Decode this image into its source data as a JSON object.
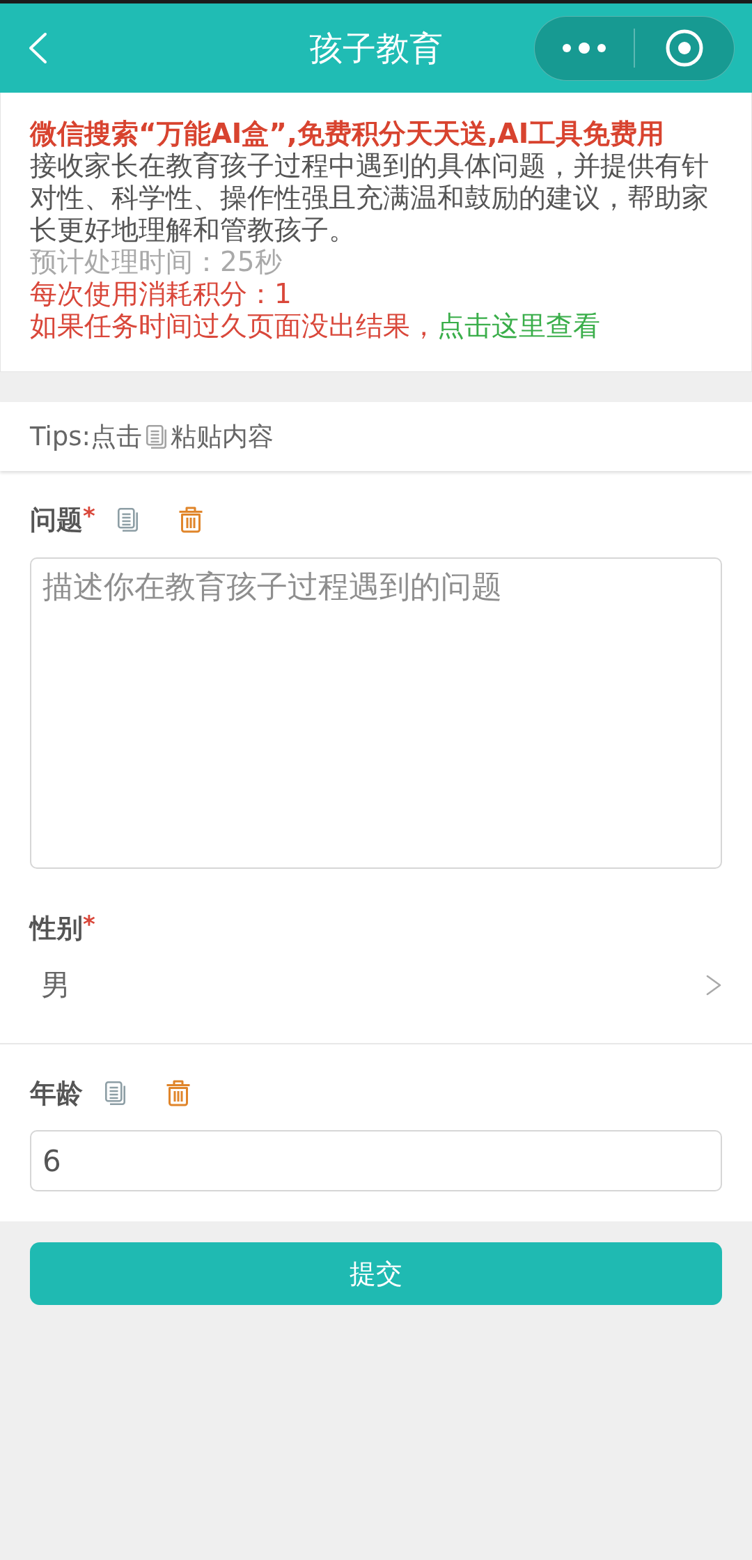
{
  "header": {
    "title": "孩子教育"
  },
  "info_card": {
    "promo": "微信搜索“万能AI盒”,免费积分天天送,AI工具免费用",
    "description": "接收家长在教育孩子过程中遇到的具体问题，并提供有针对性、科学性、操作性强且充满温和鼓励的建议，帮助家长更好地理解和管教孩子。",
    "estimated_time": "预计处理时间：25秒",
    "cost": "每次使用消耗积分：1",
    "timeout_note": "如果任务时间过久页面没出结果，",
    "timeout_link": "点击这里查看"
  },
  "tips": {
    "lead": "Tips:点击",
    "trail": "粘贴内容"
  },
  "fields": [
    {
      "kind": "textarea",
      "label": "问题",
      "required_mark": "*",
      "placeholder": "描述你在教育孩子过程遇到的问题"
    },
    {
      "kind": "select",
      "label": "性别",
      "required_mark": "*",
      "value": "男"
    },
    {
      "kind": "input",
      "label": "年龄",
      "value": "6"
    }
  ],
  "submit": {
    "label": "提交"
  }
}
